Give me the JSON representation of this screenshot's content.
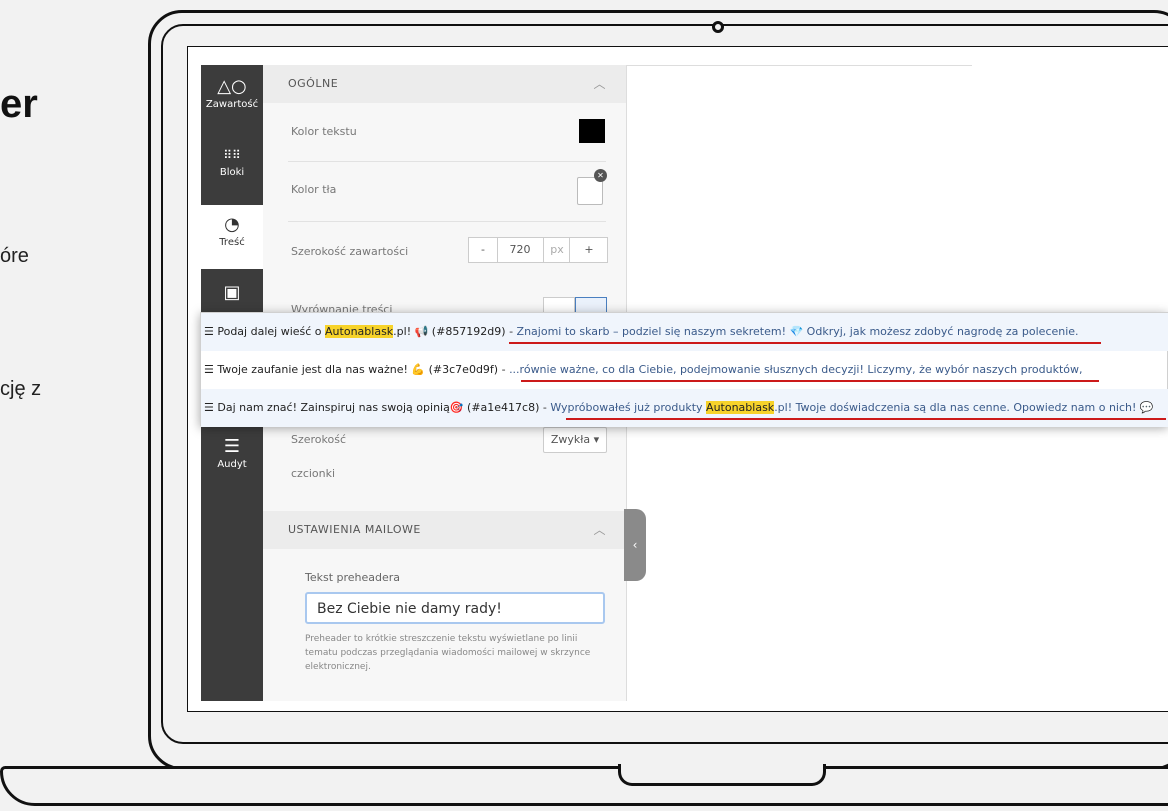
{
  "hero": {
    "title": "er",
    "line1": "óre",
    "line2": "cję z"
  },
  "sidebar": {
    "items": [
      {
        "label": "Zawartość",
        "icon": "shapes-icon"
      },
      {
        "label": "Bloki",
        "icon": "grid-icon"
      },
      {
        "label": "Treść",
        "icon": "palette-icon"
      },
      {
        "label": "",
        "icon": "image-icon"
      },
      {
        "label": "Audyt",
        "icon": "checklist-icon"
      }
    ]
  },
  "panel": {
    "general": {
      "title": "OGÓLNE"
    },
    "text_color_label": "Kolor tekstu",
    "bg_color_label": "Kolor tła",
    "content_width_label": "Szerokość zawartości",
    "content_width": {
      "minus": "-",
      "value": "720",
      "unit": "px",
      "plus": "+"
    },
    "alignment_label": "Wyrównanie treści",
    "font_width_label": "Szerokość",
    "font_label2": "czcionki",
    "font_width_value": "Zwykła ▾",
    "mail_settings": {
      "title": "USTAWIENIA MAILOWE"
    },
    "preheader_label": "Tekst preheadera",
    "preheader_value": "Bez Ciebie nie damy rady!",
    "preheader_help": "Preheader to krótkie streszczenie tekstu wyświetlane po linii tematu podczas przeglądania wiadomości mailowej w skrzynce elektronicznej."
  },
  "overlay": {
    "rows": [
      {
        "prefix": "☰ Podaj dalej wieść o ",
        "brand": "Autonablask",
        "rest": ".pl! 📢 (#857192d9) ",
        "dash": "- ",
        "body": "Znajomi to skarb – podziel się naszym sekretem! 💎 Odkryj, jak możesz zdobyć nagrodę za polecenie."
      },
      {
        "prefix": "☰ Twoje zaufanie jest dla nas ważne! 💪 (#3c7e0d9f) ",
        "brand": "",
        "rest": "",
        "dash": "- ",
        "body": "...równie ważne, co dla Ciebie, podejmowanie słusznych decyzji! Liczymy, że wybór naszych produktów,"
      },
      {
        "prefix": "☰ Daj nam znać! Zainspiruj nas swoją opinią🎯 (#a1e417c8) ",
        "brand": "",
        "rest": "",
        "dash": "- ",
        "body": "Wypróbowałeś już produkty ",
        "brand2": "Autonablask",
        "body2": ".pl! Twoje doświadczenia są dla nas cenne. Opowiedz nam o nich! 💬"
      }
    ]
  },
  "colors": {
    "sidebar": "#3c3c3c",
    "highlight": "#f7d32a",
    "underline": "#cc1a1a"
  }
}
